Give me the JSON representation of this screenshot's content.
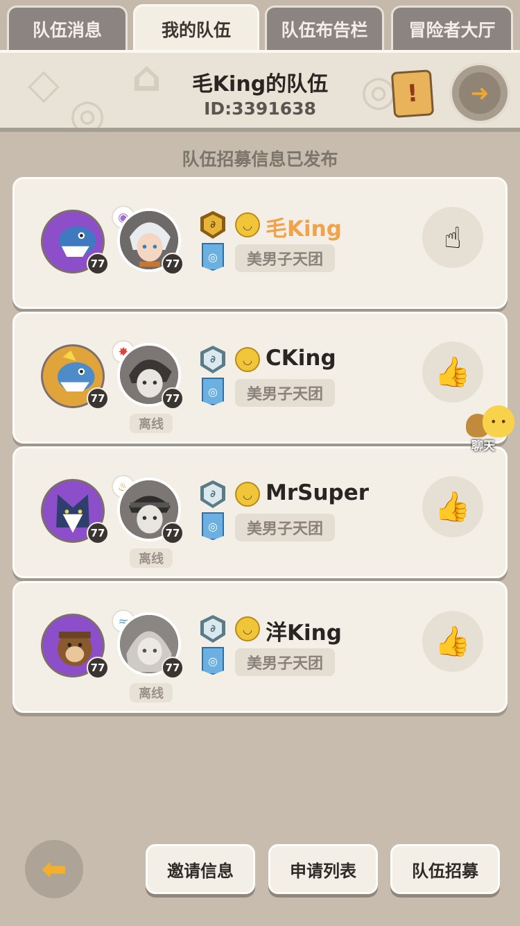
{
  "tabs": [
    {
      "label": "队伍消息",
      "active": false
    },
    {
      "label": "我的队伍",
      "active": true
    },
    {
      "label": "队伍布告栏",
      "active": false
    },
    {
      "label": "冒险者大厅",
      "active": false
    }
  ],
  "header": {
    "title": "毛King的队伍",
    "id_text": "ID:3391638",
    "notice_icon": "scroll-icon",
    "exit_icon": "exit-door-icon"
  },
  "status_text": "队伍招募信息已发布",
  "members": [
    {
      "name": "毛King",
      "is_leader": true,
      "pet_level": "77",
      "player_level": "77",
      "guild": "美男子天团",
      "offline_label": "",
      "pet_color": "#8c4fc9",
      "action_icon": "scroll-tap-icon"
    },
    {
      "name": "CKing",
      "is_leader": false,
      "pet_level": "77",
      "player_level": "77",
      "guild": "美男子天团",
      "offline_label": "离线",
      "pet_color": "#e0a43a",
      "action_icon": "thumbs-up-icon"
    },
    {
      "name": "MrSuper",
      "is_leader": false,
      "pet_level": "77",
      "player_level": "77",
      "guild": "美男子天团",
      "offline_label": "离线",
      "pet_color": "#8c4fc9",
      "action_icon": "thumbs-up-icon"
    },
    {
      "name": "洋King",
      "is_leader": false,
      "pet_level": "77",
      "player_level": "77",
      "guild": "美男子天团",
      "offline_label": "离线",
      "pet_color": "#8c4fc9",
      "action_icon": "thumbs-up-icon"
    }
  ],
  "chat": {
    "label": "聊天"
  },
  "bottom": {
    "invite_label": "邀请信息",
    "apply_label": "申请列表",
    "recruit_label": "队伍招募",
    "back_icon": "back-arrow-icon"
  }
}
